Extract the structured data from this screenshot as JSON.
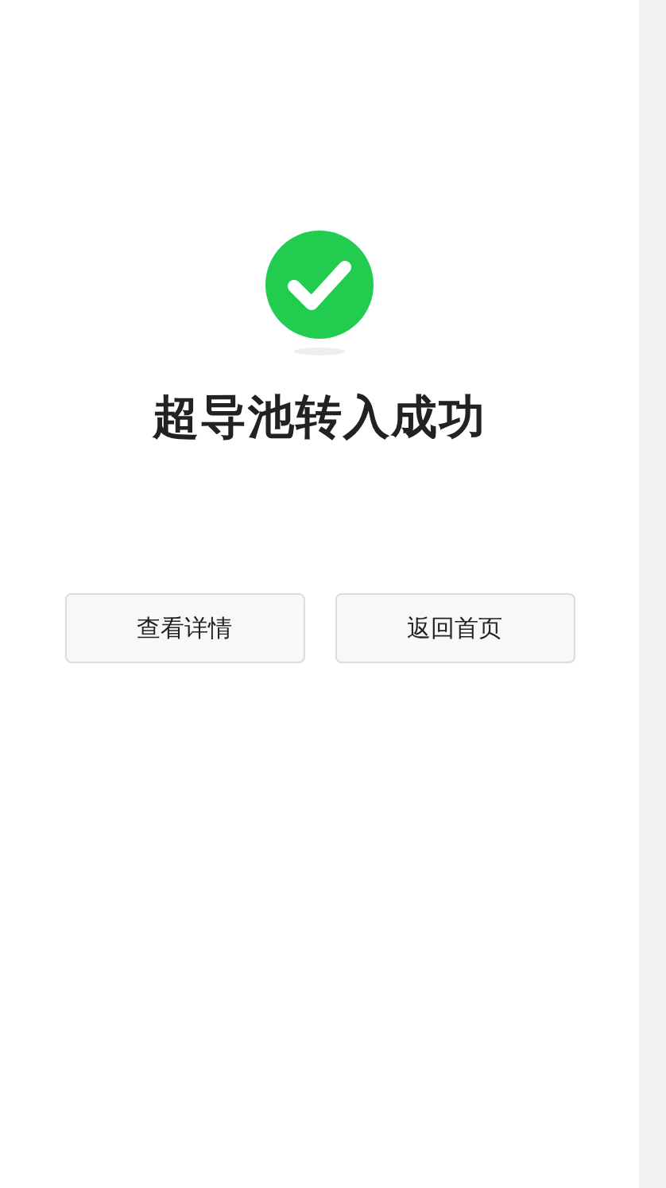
{
  "result": {
    "title": "超导池转入成功"
  },
  "buttons": [
    {
      "label": "查看详情"
    },
    {
      "label": "返回首页"
    }
  ]
}
